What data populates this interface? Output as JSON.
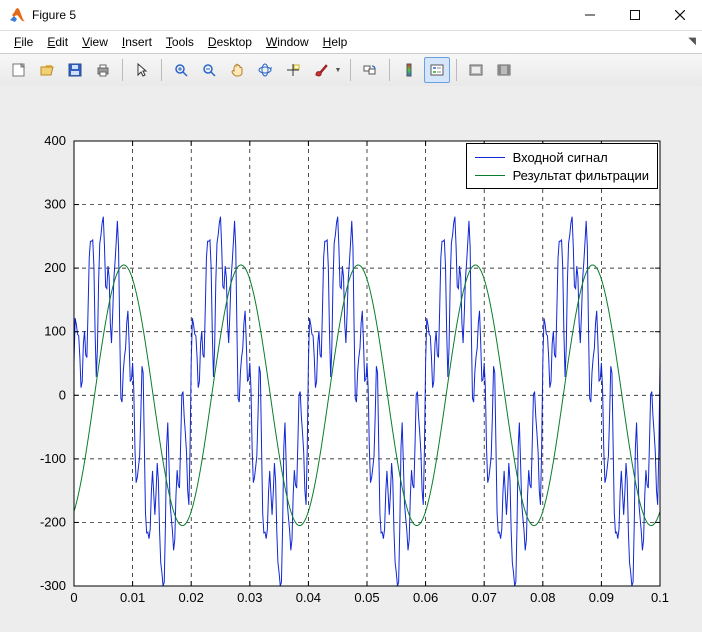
{
  "window": {
    "title": "Figure 5"
  },
  "menu": {
    "items": [
      {
        "label": "File",
        "mn": "F"
      },
      {
        "label": "Edit",
        "mn": "E"
      },
      {
        "label": "View",
        "mn": "V"
      },
      {
        "label": "Insert",
        "mn": "I"
      },
      {
        "label": "Tools",
        "mn": "T"
      },
      {
        "label": "Desktop",
        "mn": "D"
      },
      {
        "label": "Window",
        "mn": "W"
      },
      {
        "label": "Help",
        "mn": "H"
      }
    ]
  },
  "toolbar": {
    "buttons": [
      "new-figure",
      "open",
      "save",
      "print",
      "|",
      "pointer",
      "|",
      "zoom-in",
      "zoom-out",
      "pan",
      "rotate",
      "data-cursor",
      "brush",
      "|",
      "link",
      "|",
      "colorbar",
      "legend",
      "|",
      "hide-tools",
      "dock"
    ],
    "active": "legend"
  },
  "legend": {
    "entries": [
      {
        "label": "Входной сигнал",
        "color": "#1127d6"
      },
      {
        "label": "Результат фильтрации",
        "color": "#0a7d2c"
      }
    ]
  },
  "chart_data": {
    "type": "line",
    "title": "",
    "xlabel": "",
    "ylabel": "",
    "xlim": [
      0,
      0.1
    ],
    "ylim": [
      -300,
      400
    ],
    "xticks": [
      0,
      0.01,
      0.02,
      0.03,
      0.04,
      0.05,
      0.06,
      0.07,
      0.08,
      0.09,
      0.1
    ],
    "yticks": [
      -300,
      -200,
      -100,
      0,
      100,
      200,
      300,
      400
    ],
    "grid": {
      "x": true,
      "y": true,
      "style": "dashed"
    },
    "box": true,
    "legend_position": "upper right",
    "x_generate": {
      "start": 0.0,
      "stop": 0.1,
      "step": 0.0002
    },
    "series": [
      {
        "name": "Входной сигнал",
        "color": "#1127d6",
        "width": 1.0,
        "model": {
          "type": "sum_of_sines",
          "components": [
            {
              "amp": 200,
              "freq_hz": 50,
              "phase_deg": 0
            },
            {
              "amp": 80,
              "freq_hz": 450,
              "phase_deg": 0
            },
            {
              "amp": 50,
              "freq_hz": 700,
              "phase_deg": 30
            },
            {
              "amp": 30,
              "freq_hz": 1200,
              "phase_deg": 60
            }
          ]
        }
      },
      {
        "name": "Результат фильтрации",
        "color": "#0a7d2c",
        "width": 1.0,
        "model": {
          "type": "sum_of_sines",
          "components": [
            {
              "amp": 205,
              "freq_hz": 50,
              "phase_deg": -63
            }
          ]
        }
      }
    ]
  }
}
